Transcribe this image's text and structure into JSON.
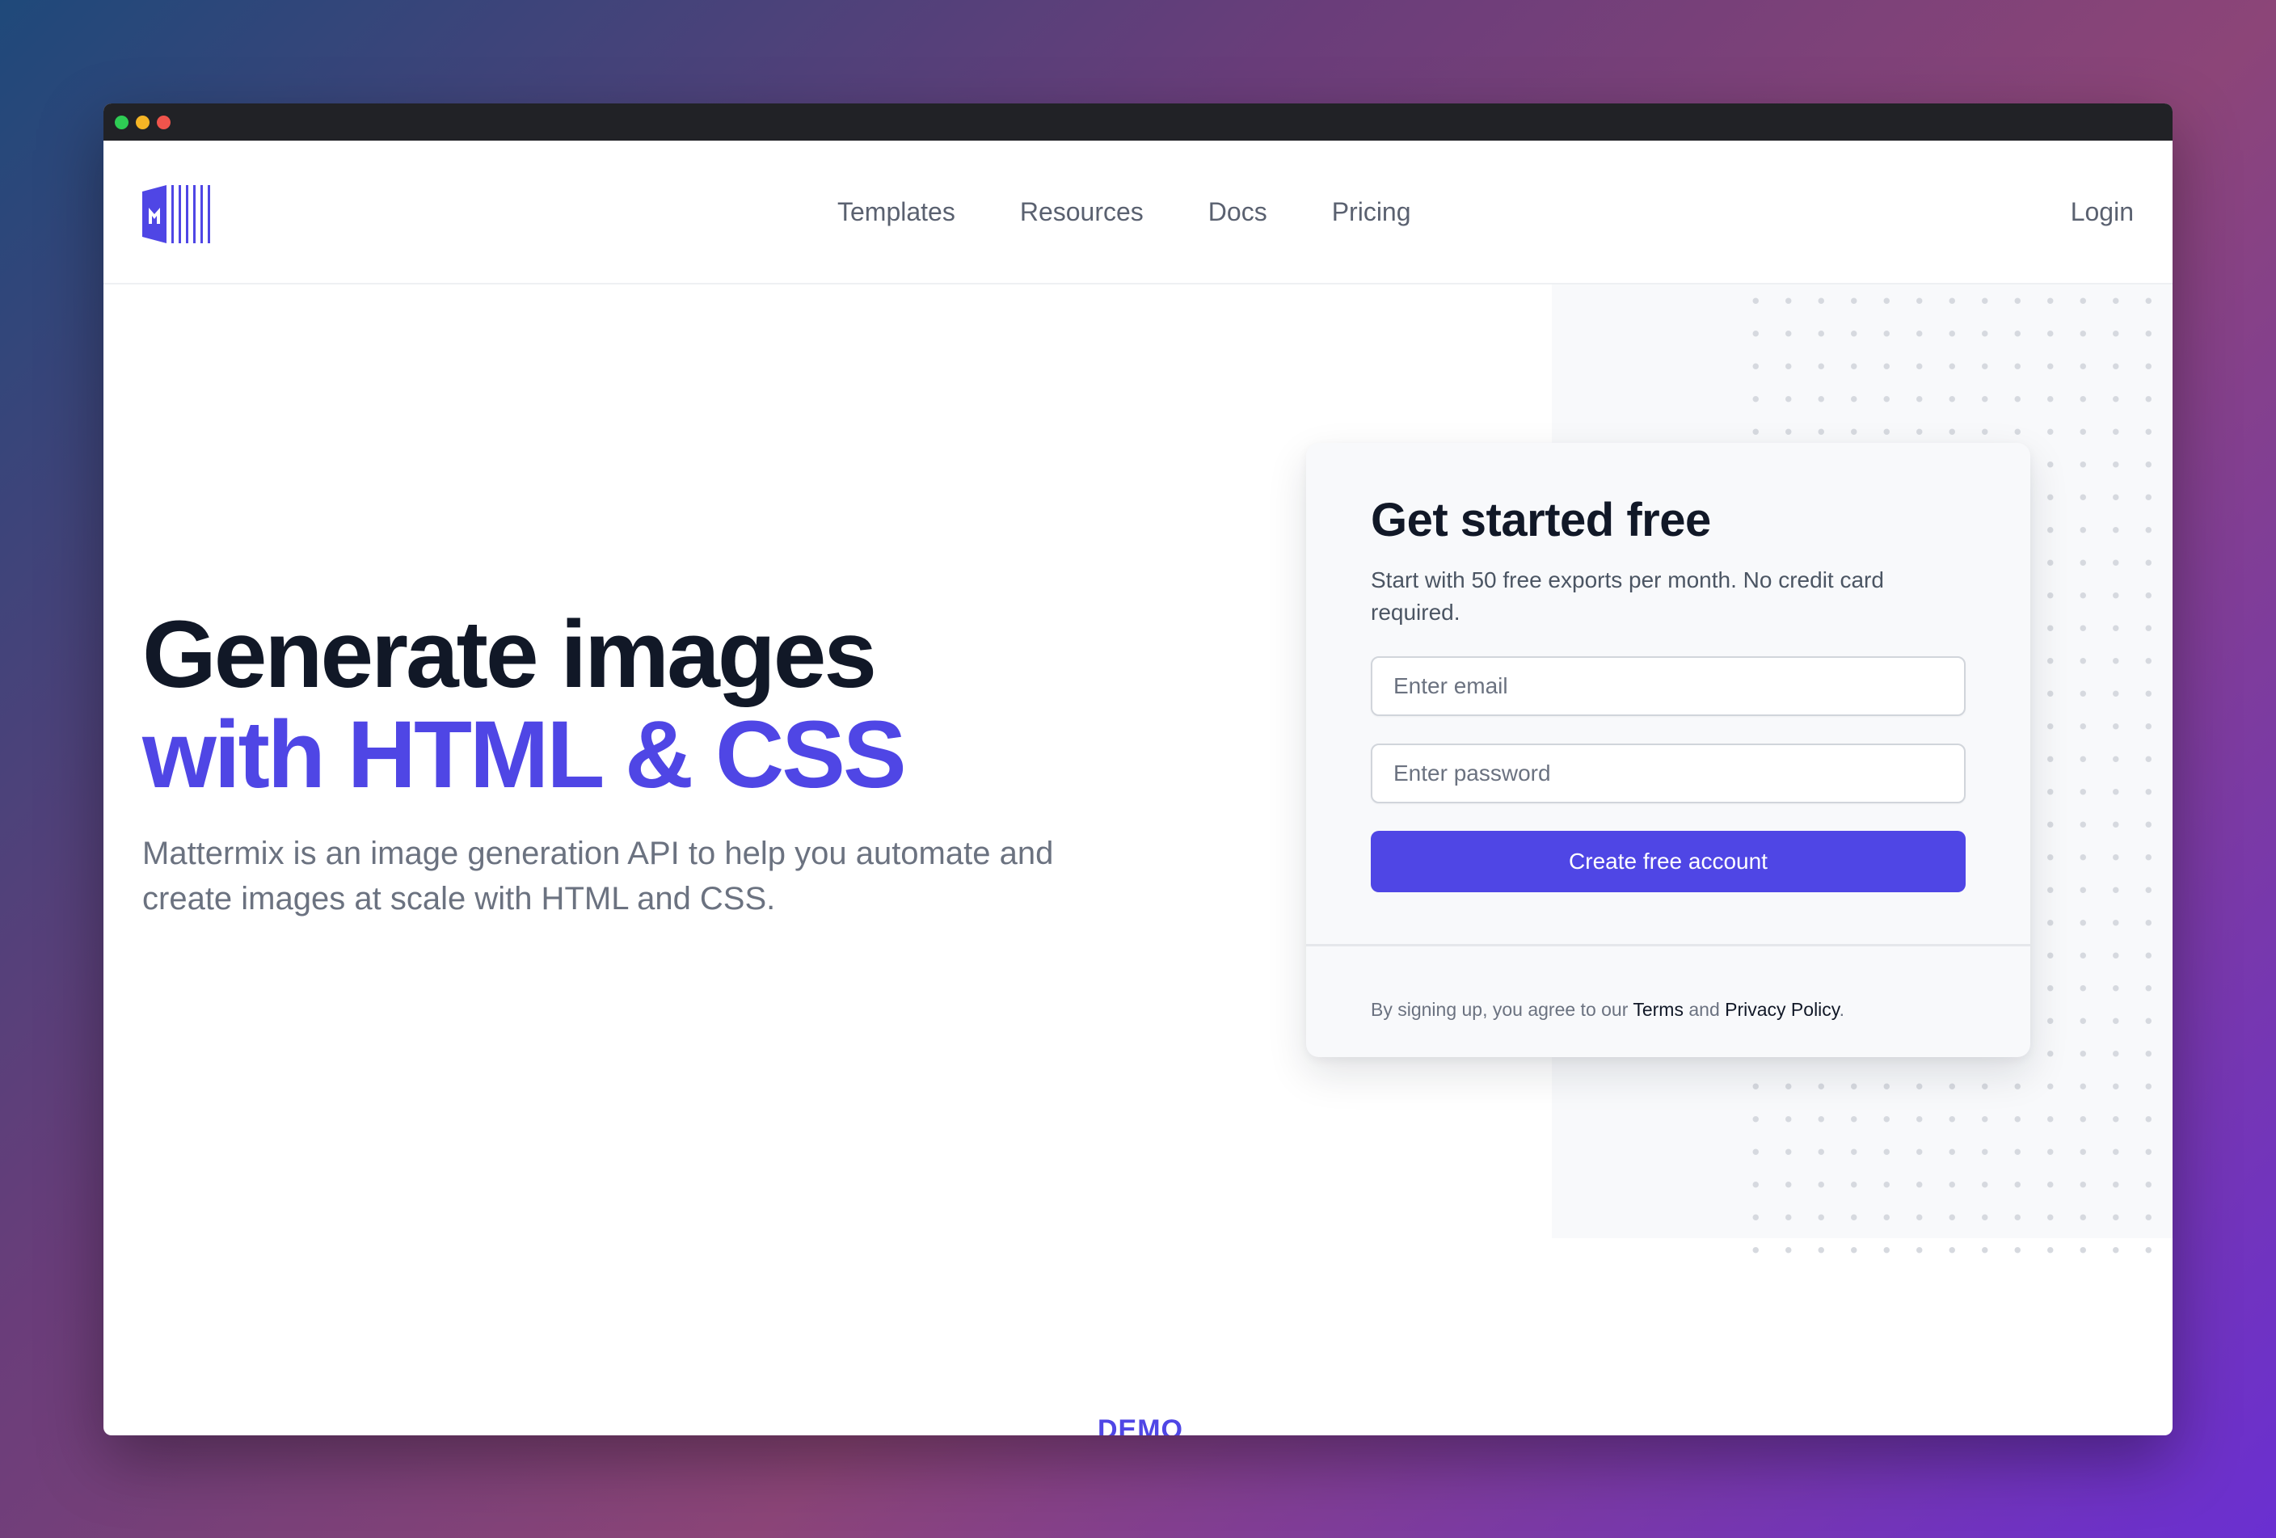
{
  "nav": {
    "links": [
      "Templates",
      "Resources",
      "Docs",
      "Pricing"
    ],
    "login": "Login"
  },
  "hero": {
    "title_line1": "Generate images",
    "title_line2": "with HTML & CSS",
    "description": "Mattermix is an image generation API to help you automate and create images at scale with HTML and CSS."
  },
  "signup": {
    "title": "Get started free",
    "subtitle": "Start with 50 free exports per month. No credit card required.",
    "email_placeholder": "Enter email",
    "password_placeholder": "Enter password",
    "submit_label": "Create free account",
    "legal_prefix": "By signing up, you agree to our",
    "terms": "Terms",
    "and": "and",
    "privacy": "Privacy Policy",
    "period": "."
  },
  "demo_label": "DEMO",
  "colors": {
    "accent": "#4f46e5",
    "heading": "#111827",
    "muted": "#6b7280"
  }
}
